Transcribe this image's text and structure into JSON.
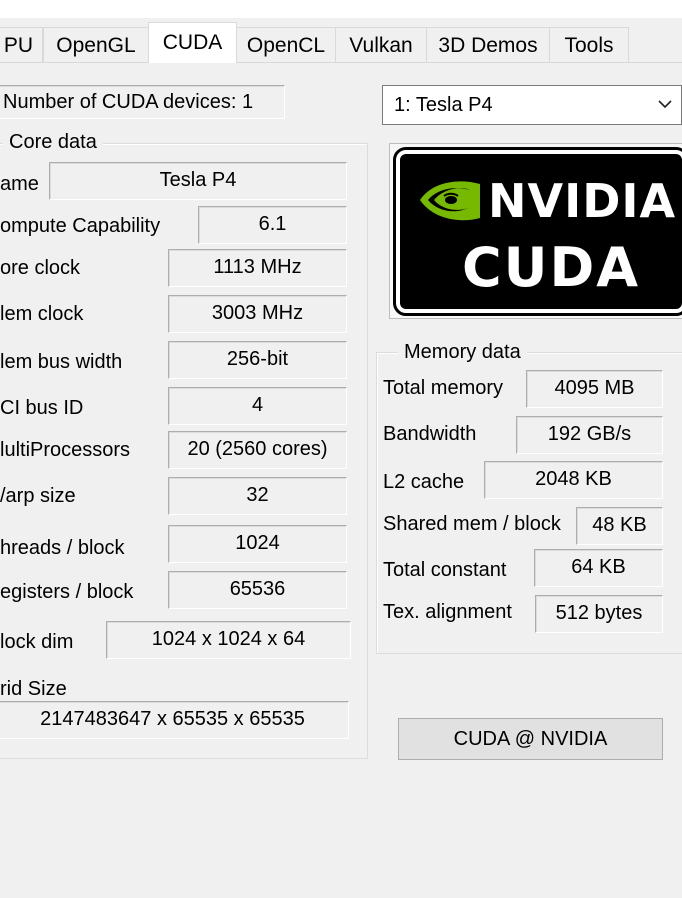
{
  "tabs": [
    {
      "label": "PU"
    },
    {
      "label": "OpenGL"
    },
    {
      "label": "CUDA"
    },
    {
      "label": "OpenCL"
    },
    {
      "label": "Vulkan"
    },
    {
      "label": "3D Demos"
    },
    {
      "label": "Tools"
    }
  ],
  "device_count": "Number of CUDA devices: 1",
  "device_select": {
    "selected": "1: Tesla P4"
  },
  "core": {
    "title": "Core data",
    "rows": [
      {
        "label": "ame",
        "value": "Tesla P4"
      },
      {
        "label": "ompute Capability",
        "value": "6.1"
      },
      {
        "label": "ore clock",
        "value": "1113 MHz"
      },
      {
        "label": "lem clock",
        "value": "3003 MHz"
      },
      {
        "label": "lem bus width",
        "value": "256-bit"
      },
      {
        "label": "CI bus ID",
        "value": "4"
      },
      {
        "label": "lultiProcessors",
        "value": "20 (2560 cores)"
      },
      {
        "label": "/arp size",
        "value": "32"
      },
      {
        "label": "hreads / block",
        "value": "1024"
      },
      {
        "label": "egisters / block",
        "value": "65536"
      },
      {
        "label": "lock dim",
        "value": "1024 x 1024 x 64"
      },
      {
        "label": "rid Size",
        "value": "2147483647 x 65535 x 65535"
      }
    ]
  },
  "memory": {
    "title": "Memory data",
    "rows": [
      {
        "label": "Total memory",
        "value": "4095 MB"
      },
      {
        "label": "Bandwidth",
        "value": "192 GB/s"
      },
      {
        "label": "L2 cache",
        "value": "2048 KB"
      },
      {
        "label": "Shared mem / block",
        "value": "48 KB"
      },
      {
        "label": "Total constant",
        "value": "64 KB"
      },
      {
        "label": "Tex. alignment",
        "value": "512 bytes"
      }
    ]
  },
  "logo": {
    "brand": "NVIDIA",
    "product": "CUDA",
    "icon": "nvidia-eye-icon"
  },
  "link_button": "CUDA @ NVIDIA",
  "colors": {
    "nvidia_green": "#76b900",
    "background": "#f0f0f0"
  }
}
